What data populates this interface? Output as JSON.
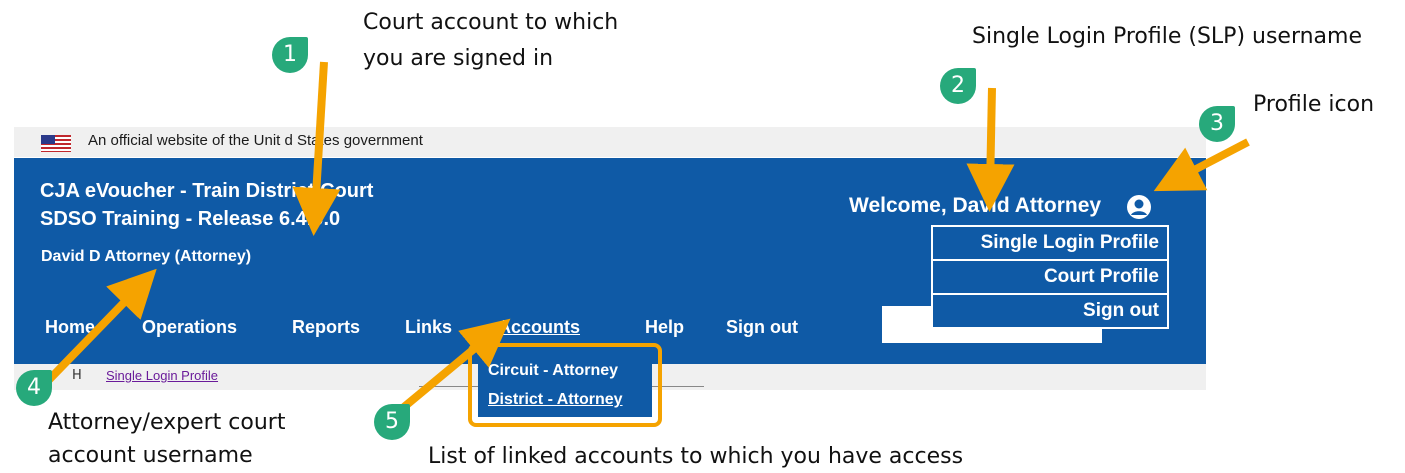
{
  "gov_banner": {
    "text": "An official website of the Unit d States government"
  },
  "header": {
    "court_title": "CJA eVoucher - Train District Court",
    "court_subtitle": "SDSO Training - Release 6.4.0.0",
    "signed_in_user": "David D Attorney (Attorney)",
    "welcome": "Welcome, David Attorney"
  },
  "nav": {
    "items": [
      "Home",
      "Operations",
      "Reports",
      "Links",
      "Accounts",
      "Help",
      "Sign out"
    ]
  },
  "profile_menu": {
    "items": [
      "Single Login Profile",
      "Court Profile",
      "Sign out"
    ]
  },
  "accounts_menu": {
    "items": [
      "Circuit - Attorney",
      "District - Attorney"
    ]
  },
  "breadcrumb": {
    "home": "H",
    "current": "Single Login Profile"
  },
  "callouts": {
    "c1_line1": "Court account to which",
    "c1_line2": "you are signed in",
    "c2": "Single Login Profile (SLP) username",
    "c3": "Profile icon",
    "c4_line1": "Attorney/expert court",
    "c4_line2": "account username",
    "c5": "List of linked accounts to which you have access"
  },
  "badges": [
    "1",
    "2",
    "3",
    "4",
    "5"
  ],
  "colors": {
    "header_bg": "#0f5aa6",
    "arrow": "#f5a300",
    "badge": "#27a97b"
  }
}
